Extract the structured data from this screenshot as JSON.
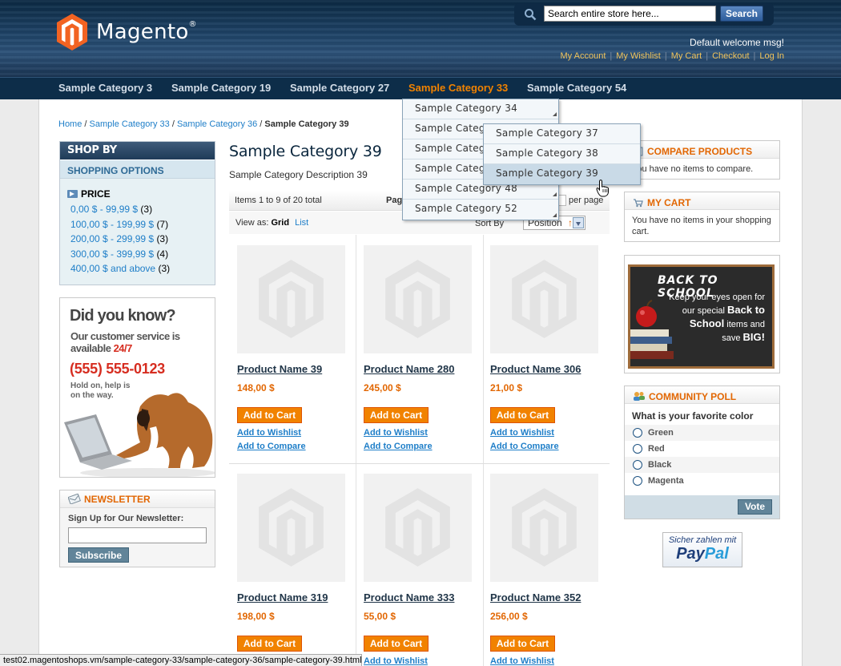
{
  "header": {
    "brand": "Magento",
    "search_placeholder": "Search entire store here...",
    "search_button": "Search",
    "welcome": "Default welcome msg!",
    "links": [
      "My Account",
      "My Wishlist",
      "My Cart",
      "Checkout",
      "Log In"
    ]
  },
  "nav": {
    "items": [
      "Sample Category 3",
      "Sample Category 19",
      "Sample Category 27",
      "Sample Category 33",
      "Sample Category 54"
    ],
    "active_index": 3
  },
  "dropdown": {
    "level1": [
      "Sample Category 34",
      "Sample Catego",
      "Sample Catego",
      "Sample Catego",
      "Sample Category 48",
      "Sample Category 52"
    ],
    "level2": [
      "Sample Category 37",
      "Sample Category 38",
      "Sample Category 39"
    ],
    "hovered": "Sample Category 39"
  },
  "breadcrumbs": {
    "items": [
      "Home",
      "Sample Category 33",
      "Sample Category 36"
    ],
    "current": "Sample Category 39"
  },
  "shopby": {
    "title": "SHOP BY",
    "subtitle": "SHOPPING OPTIONS",
    "filter_name": "PRICE",
    "ranges": [
      {
        "label": "0,00 $ - 99,99 $",
        "count": "(3)"
      },
      {
        "label": "100,00 $ - 199,99 $",
        "count": "(7)"
      },
      {
        "label": "200,00 $ - 299,99 $",
        "count": "(3)"
      },
      {
        "label": "300,00 $ - 399,99 $",
        "count": "(4)"
      },
      {
        "label": "400,00 $ and above",
        "count": "(3)"
      }
    ]
  },
  "did_you_know": {
    "title": "Did you know?",
    "line1": "Our customer service is available",
    "hours": "24/7",
    "phone": "(555) 555-0123",
    "line2": "Hold on, help is on the way."
  },
  "newsletter": {
    "title": "NEWSLETTER",
    "label": "Sign Up for Our Newsletter:",
    "button": "Subscribe"
  },
  "category": {
    "title": "Sample Category 39",
    "description": "Sample Category Description 39"
  },
  "toolbar": {
    "amount": "Items 1 to 9 of 20 total",
    "page_label": "Pag",
    "per_page": "per page",
    "view_as": "View as:",
    "grid": "Grid",
    "list": "List",
    "sort_by": "Sort By",
    "sort_value": "Position",
    "direction_icon": "↑"
  },
  "products": [
    {
      "name": "Product Name 39",
      "price": "148,00 $"
    },
    {
      "name": "Product Name 280",
      "price": "245,00 $"
    },
    {
      "name": "Product Name 306",
      "price": "21,00 $"
    },
    {
      "name": "Product Name 319",
      "price": "198,00 $"
    },
    {
      "name": "Product Name 333",
      "price": "55,00 $"
    },
    {
      "name": "Product Name 352",
      "price": "256,00 $"
    }
  ],
  "product_actions": {
    "add_to_cart": "Add to Cart",
    "add_to_wishlist": "Add to Wishlist",
    "add_to_compare": "Add to Compare"
  },
  "compare": {
    "title": "COMPARE PRODUCTS",
    "text": "You have no items to compare."
  },
  "cart": {
    "title": "MY CART",
    "text": "You have no items in your shopping cart."
  },
  "banner": {
    "title": "BACK TO SCHOOL",
    "text_a": "Keep your eyes open for our special",
    "text_b": "Back to School",
    "text_c": "items and save",
    "text_d": "BIG!"
  },
  "poll": {
    "title": "COMMUNITY POLL",
    "question": "What is your favorite color",
    "options": [
      "Green",
      "Red",
      "Black",
      "Magenta"
    ],
    "button": "Vote"
  },
  "paypal": {
    "line1": "Sicher zahlen mit",
    "pay": "Pay",
    "pal": "Pal"
  },
  "status_bar": "test02.magentoshops.vm/sample-category-33/sample-category-36/sample-category-39.html",
  "colors": {
    "accent": "#f18200",
    "link": "#1e7ec8",
    "nav_bg": "#0d2d49"
  }
}
